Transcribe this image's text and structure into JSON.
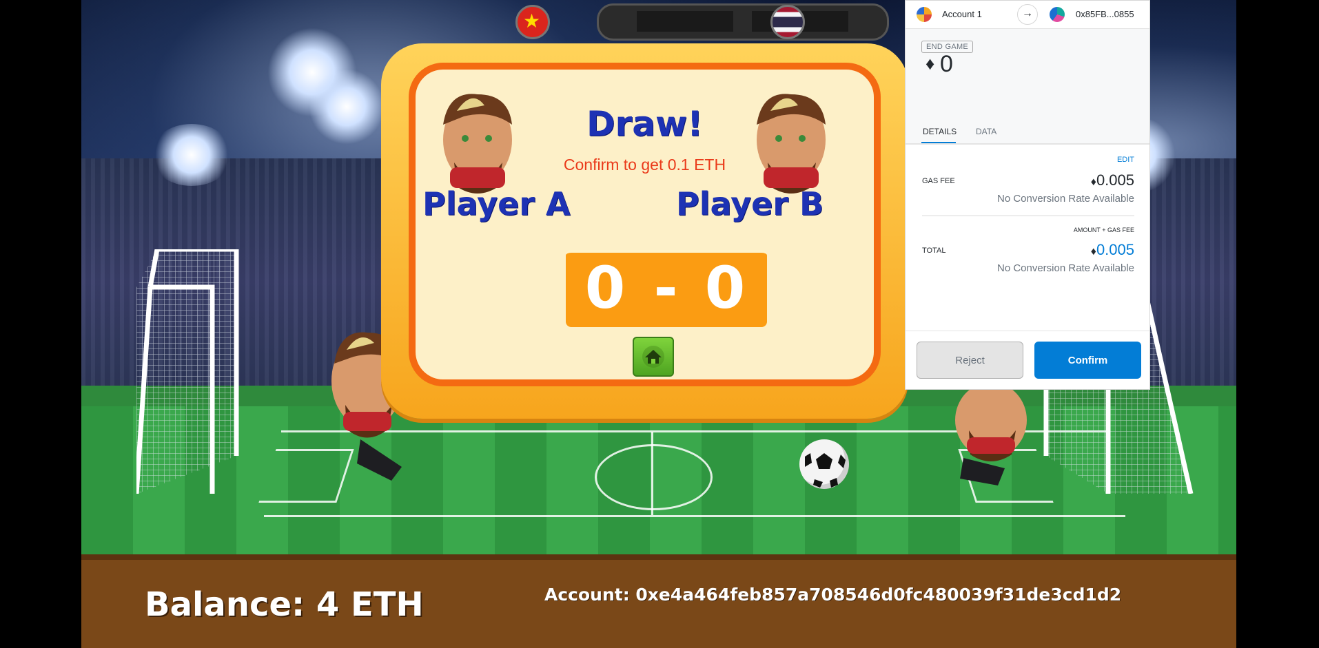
{
  "game": {
    "result_title": "Draw!",
    "result_subtitle": "Confirm to get 0.1 ETH",
    "player_a": "Player A",
    "player_b": "Player B",
    "score_a": "0",
    "score_separator": "-",
    "score_b": "0",
    "balance_text": "Balance: 4 ETH",
    "account_text": "Account: 0xe4a464feb857a708546d0fc480039f31de3cd1d2",
    "left_flag": "vietnam-flag",
    "right_flag": "thailand-flag"
  },
  "wallet": {
    "account_name": "Account 1",
    "to_address": "0x85FB...0855",
    "method_badge": "END GAME",
    "amount_symbol": "♦",
    "amount": "0",
    "tabs": [
      "DETAILS",
      "DATA"
    ],
    "edit_label": "EDIT",
    "gas_fee_label": "GAS FEE",
    "gas_fee_value": "0.005",
    "gas_fee_note": "No Conversion Rate Available",
    "amount_gas_label": "AMOUNT + GAS FEE",
    "total_label": "TOTAL",
    "total_value": "0.005",
    "total_note": "No Conversion Rate Available",
    "reject_label": "Reject",
    "confirm_label": "Confirm",
    "colors": {
      "accent": "#037dd6",
      "reject_bg": "#e4e4e4"
    }
  }
}
